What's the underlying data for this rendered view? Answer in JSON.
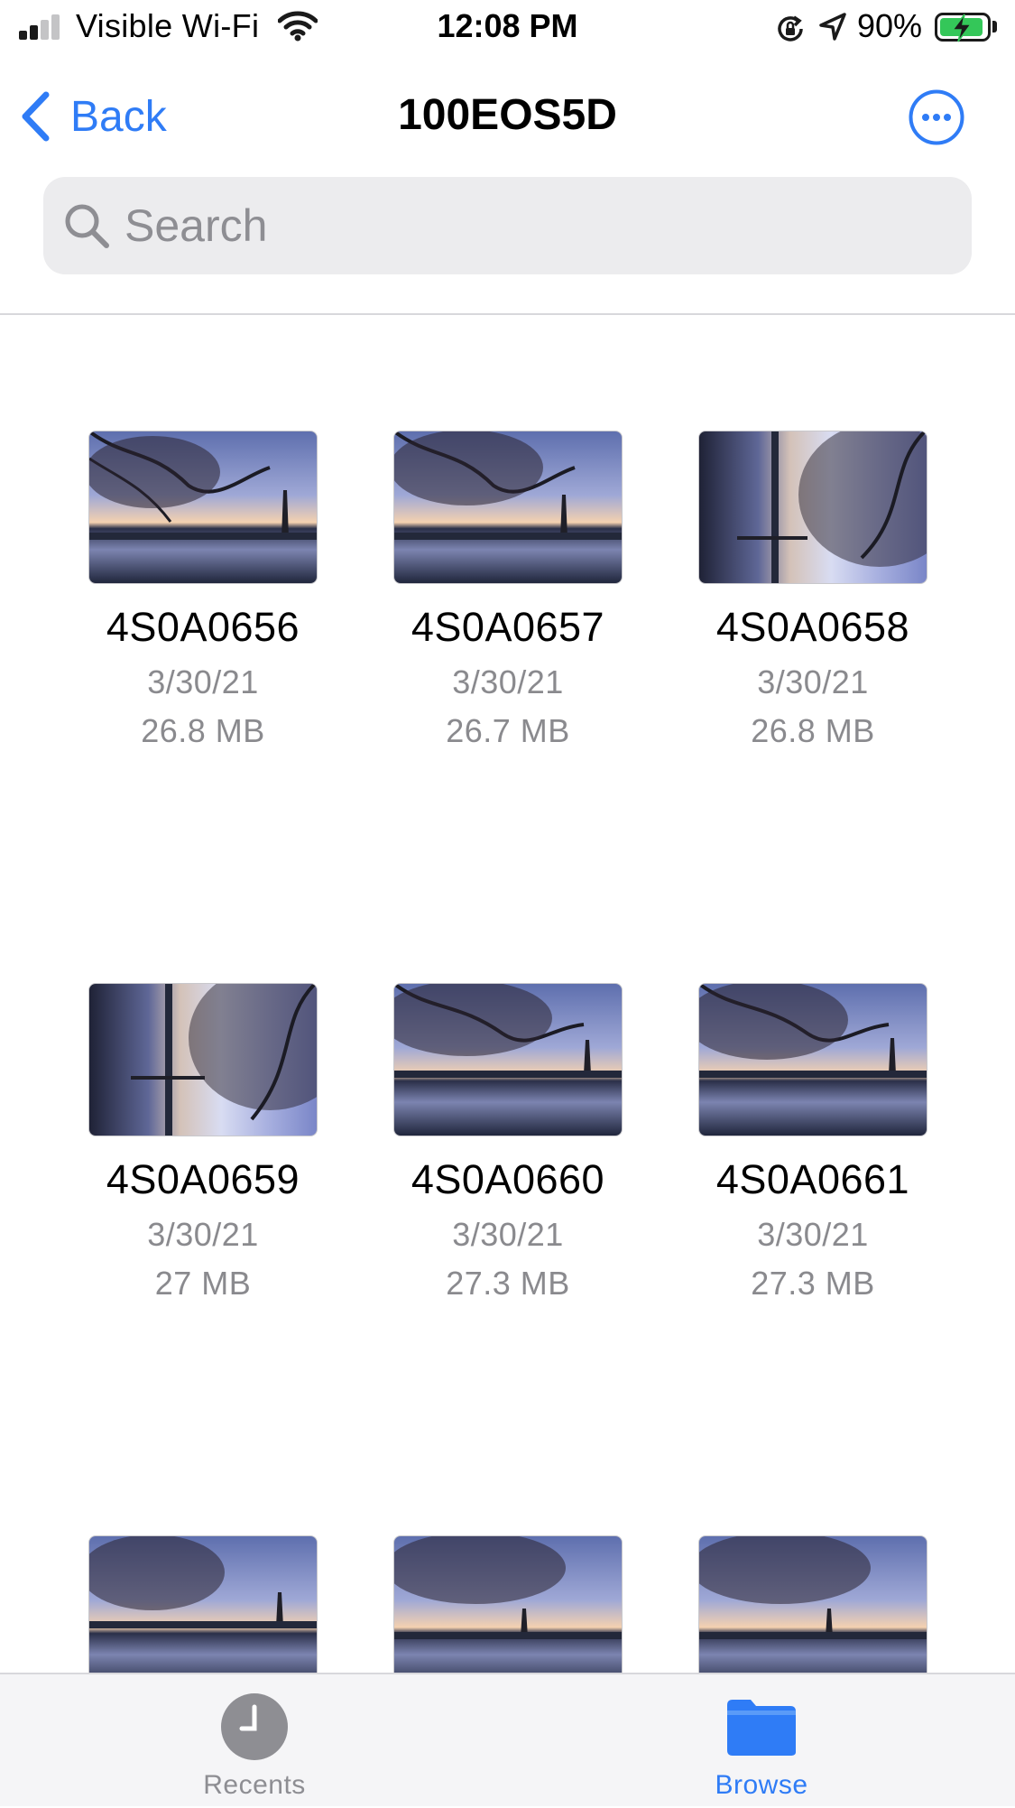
{
  "status_bar": {
    "carrier": "Visible Wi-Fi",
    "time": "12:08 PM",
    "battery_percent": "90%"
  },
  "nav": {
    "back_label": "Back",
    "title": "100EOS5D",
    "accent_color": "#2f7cf6"
  },
  "search": {
    "placeholder": "Search",
    "value": ""
  },
  "files": [
    {
      "name": "4S0A0656",
      "date": "3/30/21",
      "size": "26.8 MB",
      "orientation": "landscape"
    },
    {
      "name": "4S0A0657",
      "date": "3/30/21",
      "size": "26.7 MB",
      "orientation": "landscape"
    },
    {
      "name": "4S0A0658",
      "date": "3/30/21",
      "size": "26.8 MB",
      "orientation": "rotated"
    },
    {
      "name": "4S0A0659",
      "date": "3/30/21",
      "size": "27 MB",
      "orientation": "rotated"
    },
    {
      "name": "4S0A0660",
      "date": "3/30/21",
      "size": "27.3 MB",
      "orientation": "landscape"
    },
    {
      "name": "4S0A0661",
      "date": "3/30/21",
      "size": "27.3 MB",
      "orientation": "landscape"
    },
    {
      "orientation": "landscape"
    },
    {
      "orientation": "landscape"
    },
    {
      "orientation": "landscape"
    }
  ],
  "tab_bar": {
    "recents_label": "Recents",
    "browse_label": "Browse",
    "active_tab": "browse",
    "inactive_color": "#8e8e93"
  }
}
